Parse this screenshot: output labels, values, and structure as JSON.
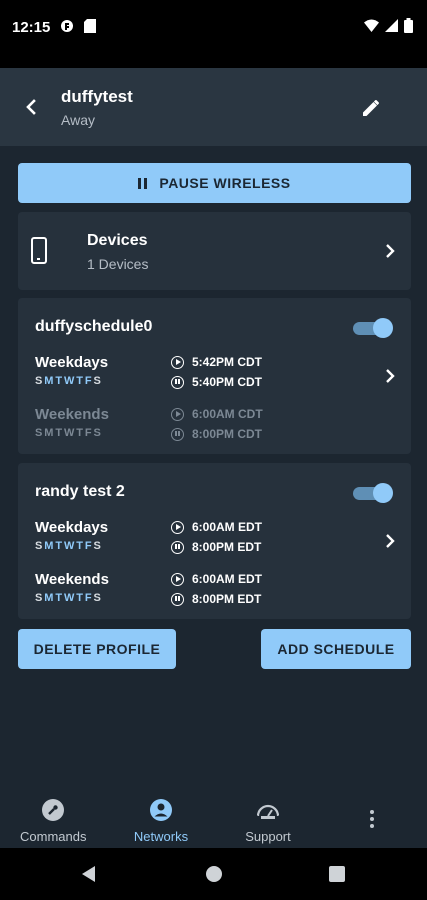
{
  "status_bar": {
    "time": "12:15"
  },
  "app_bar": {
    "title": "duffytest",
    "subtitle": "Away"
  },
  "pause_button": {
    "label": "PAUSE WIRELESS"
  },
  "devices": {
    "title": "Devices",
    "count_text": "1 Devices"
  },
  "schedules": [
    {
      "name": "duffyschedule0",
      "enabled": true,
      "rows": [
        {
          "label": "Weekdays",
          "days": [
            "S",
            "M",
            "T",
            "W",
            "T",
            "F",
            "S"
          ],
          "active_days": [
            1,
            2,
            3,
            4,
            5
          ],
          "start": "5:42PM CDT",
          "end": "5:40PM CDT",
          "dimmed": false
        },
        {
          "label": "Weekends",
          "days": [
            "S",
            "M",
            "T",
            "W",
            "T",
            "F",
            "S"
          ],
          "active_days": [],
          "start": "6:00AM CDT",
          "end": "8:00PM CDT",
          "dimmed": true
        }
      ]
    },
    {
      "name": "randy test 2",
      "enabled": true,
      "rows": [
        {
          "label": "Weekdays",
          "days": [
            "S",
            "M",
            "T",
            "W",
            "T",
            "F",
            "S"
          ],
          "active_days": [
            1,
            2,
            3,
            4,
            5
          ],
          "start": "6:00AM EDT",
          "end": "8:00PM EDT",
          "dimmed": false
        },
        {
          "label": "Weekends",
          "days": [
            "S",
            "M",
            "T",
            "W",
            "T",
            "F",
            "S"
          ],
          "active_days": [
            1,
            2,
            3,
            4,
            5
          ],
          "start": "6:00AM EDT",
          "end": "8:00PM EDT",
          "dimmed": false
        }
      ]
    }
  ],
  "actions": {
    "delete_label": "DELETE PROFILE",
    "add_label": "ADD SCHEDULE"
  },
  "bottom_nav": {
    "items": [
      {
        "label": "Commands",
        "icon": "wrench-icon",
        "active": false
      },
      {
        "label": "Networks",
        "icon": "account-circle-icon",
        "active": true
      },
      {
        "label": "Support",
        "icon": "speedometer-icon",
        "active": false
      }
    ],
    "more_icon": "more-vert-icon"
  },
  "colors": {
    "accent": "#90caf9",
    "app_bar": "#2a3641",
    "background": "#1c2630",
    "card": "#26313c"
  }
}
